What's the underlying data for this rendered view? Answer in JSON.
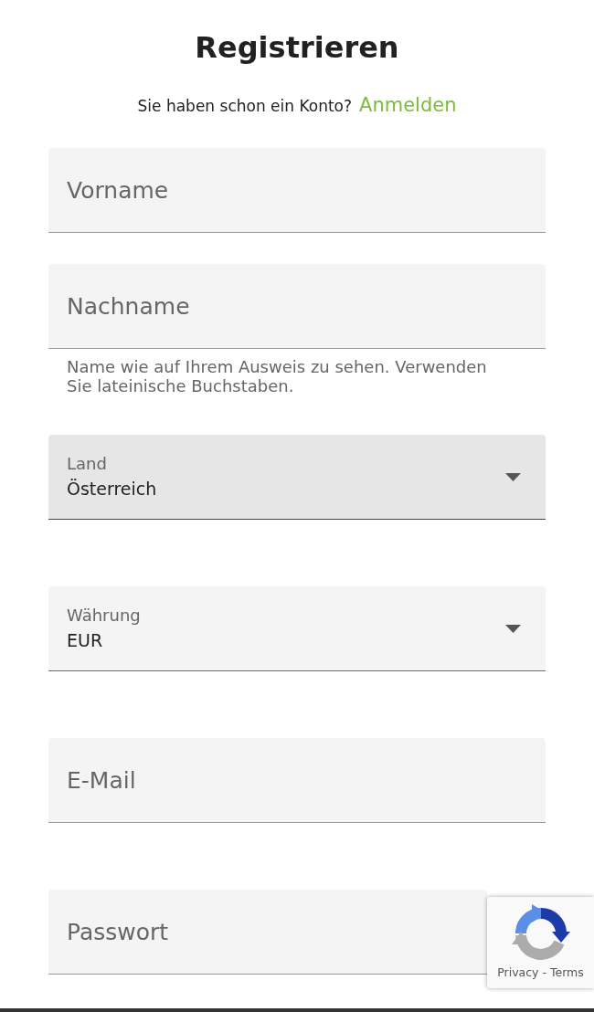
{
  "title": "Registrieren",
  "signin_prompt": {
    "text": "Sie haben schon ein Konto?",
    "link": "Anmelden"
  },
  "fields": [
    {
      "kind": "text",
      "placeholder": "Vorname",
      "focused": false
    },
    {
      "kind": "text",
      "placeholder": "Nachname",
      "focused": false,
      "hint": "Name wie auf Ihrem Ausweis zu sehen. Verwenden Sie lateinische Buchstaben."
    },
    {
      "kind": "select",
      "label": "Land",
      "value": "Österreich",
      "focused": true
    },
    {
      "kind": "select",
      "label": "Währung",
      "value": "EUR",
      "focused": false
    },
    {
      "kind": "text",
      "placeholder": "E-Mail",
      "focused": false
    },
    {
      "kind": "password",
      "placeholder": "Passwort",
      "focused": false
    }
  ],
  "recaptcha": {
    "privacy": "Privacy",
    "separator": "-",
    "terms": "Terms"
  }
}
